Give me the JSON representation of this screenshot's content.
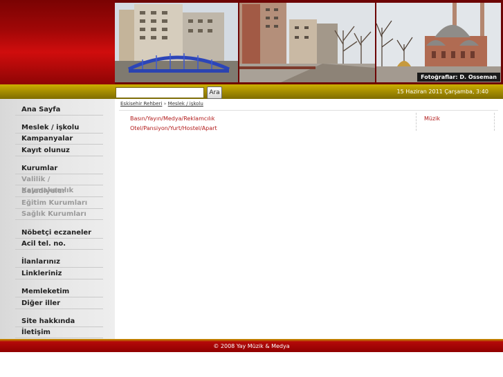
{
  "header": {
    "photo_credit": "Fotoğraflar: D. Osseman"
  },
  "search": {
    "placeholder": "",
    "button_label": "Ara"
  },
  "datetime": "15 Haziran 2011 Çarşamba, 3:40",
  "sidebar": {
    "items": [
      "Ana Sayfa",
      "Meslek / işkolu",
      "Kampanyalar",
      "Kayıt olunuz",
      "Kurumlar",
      "Valilik / Kaymakamlık",
      "Belediyeler",
      "Eğitim Kurumları",
      "Sağlık Kurumları",
      "Nöbetçi eczaneler",
      "Acil tel. no.",
      "İlanlarınız",
      "Linkleriniz",
      "Memleketim",
      "Diğer iller",
      "Site hakkında",
      "İletişim"
    ]
  },
  "breadcrumb": {
    "home": "Eskisehir Rehberi",
    "separator": "»",
    "current": "Meslek / işkolu"
  },
  "categories": [
    "Basın/Yayın/Medya/Reklamcılık",
    "Otel/Pansiyon/Yurt/Hostel/Apart",
    "Müzik"
  ],
  "footer": {
    "text": "© 2008 Yay Müzik & Medya"
  }
}
